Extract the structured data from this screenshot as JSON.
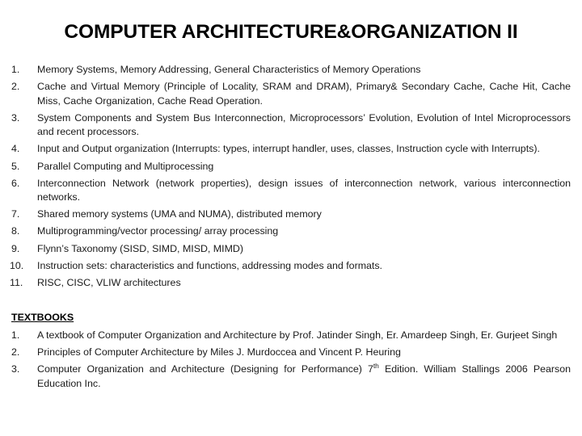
{
  "slide": {
    "title": "COMPUTER ARCHITECTURE&ORGANIZATION II",
    "background_color": "#ffffff",
    "text_color": "#1a1a1a",
    "syllabus": {
      "items": [
        {
          "number": "1.",
          "text": "Memory Systems, Memory Addressing, General Characteristics of Memory Operations"
        },
        {
          "number": "2.",
          "text": "Cache and Virtual Memory (Principle of Locality, SRAM and DRAM), Primary& Secondary Cache, Cache Hit, Cache Miss, Cache Organization, Cache Read Operation."
        },
        {
          "number": "3.",
          "text": "System Components and System Bus Interconnection, Microprocessors’ Evolution, Evolution of Intel Microprocessors and recent processors."
        },
        {
          "number": "4.",
          "text": "Input and Output organization (Interrupts: types, interrupt handler, uses, classes, Instruction cycle with Interrupts)."
        },
        {
          "number": "5.",
          "text": "Parallel Computing and Multiprocessing"
        },
        {
          "number": "6.",
          "text": "Interconnection Network (network properties), design issues of interconnection network, various interconnection networks."
        },
        {
          "number": "7.",
          "text": "Shared memory systems (UMA and NUMA), distributed  memory"
        },
        {
          "number": "8.",
          "text": "Multiprogramming/vector processing/ array processing"
        },
        {
          "number": "9.",
          "text": "Flynn’s Taxonomy (SISD, SIMD, MISD, MIMD)"
        },
        {
          "number": "10.",
          "text": "Instruction sets: characteristics and functions, addressing modes and formats."
        },
        {
          "number": "11.",
          "text": "RISC, CISC, VLIW architectures"
        }
      ]
    },
    "textbooks": {
      "heading": "TEXTBOOKS",
      "items": [
        {
          "number": "1.",
          "text": "A textbook of Computer Organization and Architecture by Prof. Jatinder Singh, Er. Amardeep Singh, Er. Gurjeet Singh"
        },
        {
          "number": "2.",
          "text": "Principles of Computer Architecture by Miles J. Murdoccea and Vincent P. Heuring"
        },
        {
          "number": "3.",
          "text_before_sup": "Computer Organization and Architecture (Designing for Performance) 7",
          "sup": "th",
          "text_after_sup": " Edition. William Stallings 2006 Pearson Education Inc."
        }
      ]
    }
  }
}
